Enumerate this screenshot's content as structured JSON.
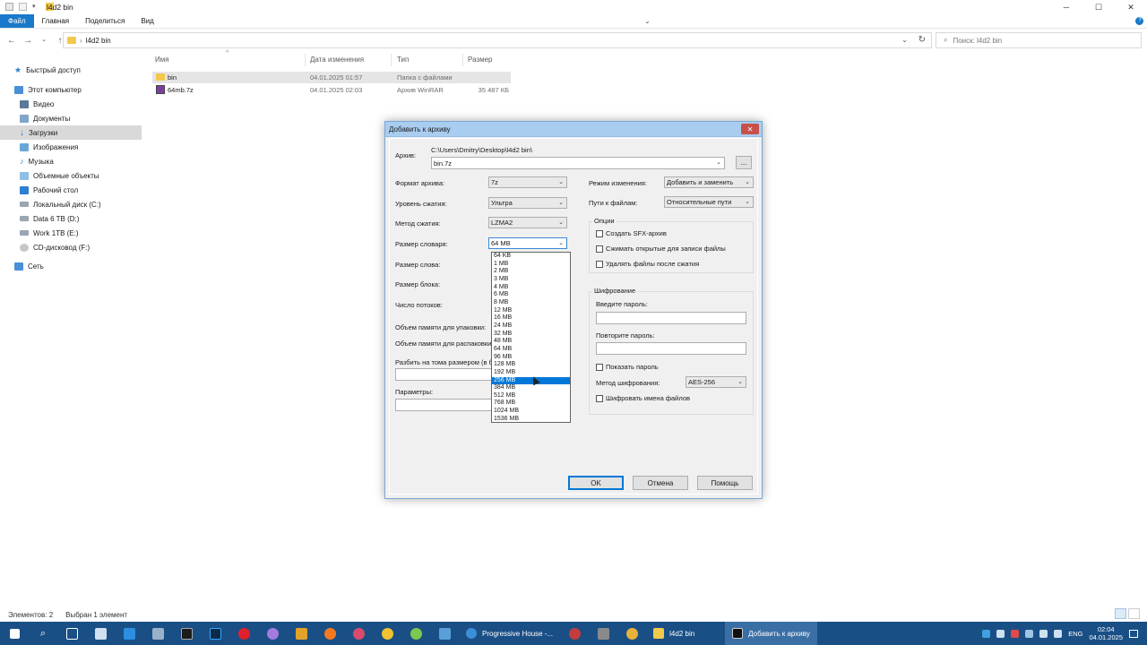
{
  "explorer": {
    "title": "l4d2 bin",
    "ribbon_tabs": [
      "Файл",
      "Главная",
      "Поделиться",
      "Вид"
    ],
    "address": "l4d2 bin",
    "search_placeholder": "Поиск: l4d2 bin",
    "nav_items": [
      "Быстрый доступ",
      "Этот компьютер",
      "Видео",
      "Документы",
      "Загрузки",
      "Изображения",
      "Музыка",
      "Объемные объекты",
      "Рабочий стол",
      "Локальный диск (C:)",
      "Data 6 TB (D:)",
      "Work 1TB (E:)",
      "CD-дисковод (F:)",
      "Сеть"
    ],
    "columns": [
      "Имя",
      "Дата изменения",
      "Тип",
      "Размер"
    ],
    "files": [
      {
        "name": "bin",
        "date": "04.01.2025 01:57",
        "type": "Папка с файлами",
        "size": ""
      },
      {
        "name": "64mb.7z",
        "date": "04.01.2025 02:03",
        "type": "Архив WinRAR",
        "size": "35 487 КБ"
      }
    ],
    "status_count": "Элементов: 2",
    "status_selected": "Выбран 1 элемент"
  },
  "dialog": {
    "title": "Добавить к архиву",
    "close_glyph": "✕",
    "archive_label": "Архив:",
    "archive_path": "C:\\Users\\Dmitry\\Desktop\\l4d2 bin\\",
    "archive_name": "bin.7z",
    "browse_label": "...",
    "format_label": "Формат архива:",
    "format_value": "7z",
    "level_label": "Уровень сжатия:",
    "level_value": "Ультра",
    "method_label": "Метод сжатия:",
    "method_value": "LZMA2",
    "dict_label": "Размер словаря:",
    "dict_value": "64 MB",
    "word_label": "Размер слова:",
    "block_label": "Размер блока:",
    "threads_label": "Число потоков:",
    "mem_pack_label": "Объем памяти для упаковки:",
    "mem_unpack_label": "Объем памяти для распаковки:",
    "split_label": "Разбить на тома размером (в б",
    "params_label": "Параметры:",
    "update_label": "Режим изменения:",
    "update_value": "Добавить и заменить",
    "paths_label": "Пути к файлам:",
    "paths_value": "Относительные пути",
    "options_title": "Опции",
    "opt_sfx": "Создать SFX-архив",
    "opt_shared": "Сжимать открытые для записи файлы",
    "opt_delete": "Удалять файлы после сжатия",
    "enc_title": "Шифрование",
    "enc_pwd_label": "Введите пароль:",
    "enc_repeat_label": "Повторите пароль:",
    "enc_show": "Показать пароль",
    "enc_method_label": "Метод шифрования:",
    "enc_method_value": "AES-256",
    "enc_names": "Шифровать имена файлов",
    "ok": "OK",
    "cancel": "Отмена",
    "help": "Помощь",
    "dict_options": [
      "64 KB",
      "1 MB",
      "2 MB",
      "3 MB",
      "4 MB",
      "6 MB",
      "8 MB",
      "12 MB",
      "16 MB",
      "24 MB",
      "32 MB",
      "48 MB",
      "64 MB",
      "96 MB",
      "128 MB",
      "192 MB",
      "256 MB",
      "384 MB",
      "512 MB",
      "768 MB",
      "1024 MB",
      "1536 MB"
    ],
    "dict_highlighted": "256 MB"
  },
  "taskbar": {
    "apps": [
      "Progressive House -...",
      "l4d2 bin",
      "Добавить к архиву"
    ],
    "lang": "ENG",
    "time": "02:04",
    "date": "04.01.2025"
  },
  "colors": {
    "taskbar": "#1a4f86",
    "accent": "#0078d7",
    "file_tab": "#1979ca",
    "dialog_title": "#a9cdf0"
  }
}
